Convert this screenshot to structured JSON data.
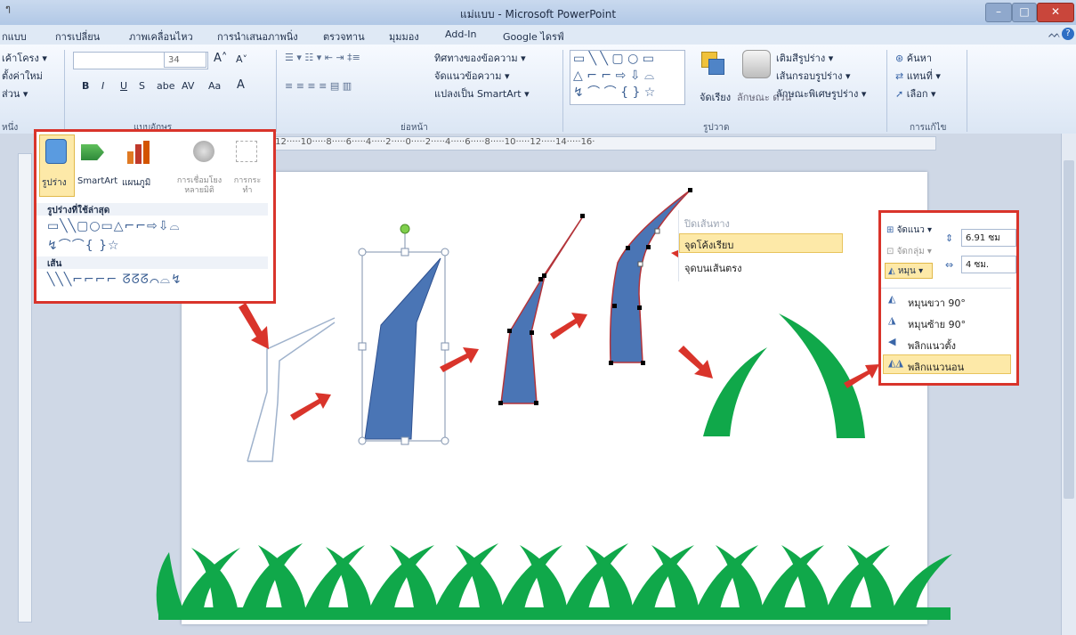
{
  "window": {
    "title": "แม่แบบ - Microsoft PowerPoint",
    "caption_fragment": "ๆ",
    "minimize": "–",
    "maximize": "□",
    "close": "✕"
  },
  "ribbon_tabs": [
    "กแบบ",
    "การเปลี่ยน",
    "ภาพเคลื่อนไหว",
    "การนำเสนอภาพนิ่ง",
    "ตรวจทาน",
    "มุมมอง",
    "Add-In",
    "Google ไดรฟ์"
  ],
  "slides_group": {
    "layout": "เค้าโครง ▾",
    "reset": "ตั้งค่าใหม่",
    "section": "ส่วน ▾",
    "label": "หนึ่ง"
  },
  "font_group": {
    "size": "34",
    "bold": "B",
    "italic": "I",
    "underline": "U",
    "strike": "S",
    "shadow": "abe",
    "spacing": "AV",
    "case": "Aa",
    "grow": "A˄",
    "shrink": "A˅",
    "label": "แบบอักษร"
  },
  "paragraph_group": {
    "text_direction": "ทิศทางของข้อความ ▾",
    "align_text": "จัดแนวข้อความ ▾",
    "convert_smartart": "แปลงเป็น SmartArt ▾",
    "label": "ย่อหน้า"
  },
  "drawing_group": {
    "arrange": "จัดเรียง",
    "quick_styles": "ลักษณะ ด่วน",
    "shape_fill": "เติมสีรูปร่าง ▾",
    "shape_outline": "เส้นกรอบรูปร่าง ▾",
    "shape_effects": "ลักษณะพิเศษรูปร่าง ▾",
    "label": "รูปวาด"
  },
  "editing_group": {
    "find": "ค้นหา",
    "replace": "แทนที่ ▾",
    "select": "เลือก ▾",
    "label": "การแก้ไข"
  },
  "shapes_panel": {
    "shapes_btn": "รูปร่าง",
    "smartart_btn": "SmartArt",
    "chart_btn": "แผนภูมิ",
    "hyperlink_btn": "การเชื่อมโยงหลายมิติ",
    "action_btn": "การกระทำ",
    "recent_heading": "รูปร่างที่ใช้ล่าสุด",
    "lines_heading": "เส้น",
    "recent_icons": "▭╲╲▢○▭△⌐⌐⇨⇩⌓",
    "recent_icons2": "↯⌒⌒{ }☆",
    "line_icons": "╲╲╲⌐⌐⌐⌐ ᘔᘔᘔ⌒⌓↯"
  },
  "ruler_text": "·12·····10·····8·····6·····4·····2·····0·····2·····4·····6·····8·····10·····12·····14·····16·",
  "context_menu": {
    "item1": "ปิดเส้นทาง",
    "item2": "จุดโค้งเรียบ",
    "item3": "จุดบนเส้นตรง"
  },
  "rotate_panel": {
    "align": "จัดแนว ▾",
    "group": "จัดกลุ่ม ▾",
    "rotate": "หมุน ▾",
    "height": "6.91 ซม",
    "width": "4 ซม.",
    "menu": [
      "หมุนขวา 90°",
      "หมุนซ้าย 90°",
      "พลิกแนวตั้ง",
      "พลิกแนวนอน"
    ]
  },
  "colors": {
    "accent_red": "#d9342b",
    "shape_blue": "#4a75b5",
    "grass_green": "#10a84a"
  }
}
